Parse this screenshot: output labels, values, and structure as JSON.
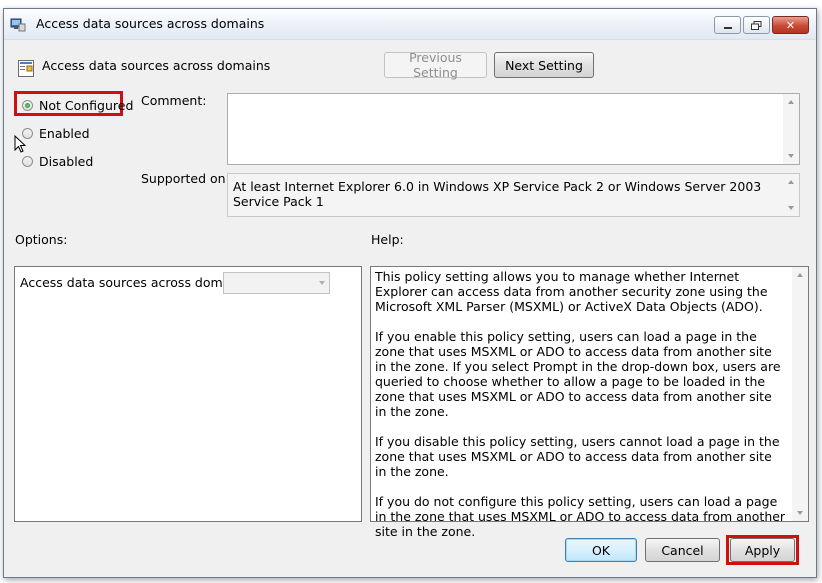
{
  "window": {
    "title": "Access data sources across domains",
    "minimize_icon": "minimize-icon",
    "maximize_icon": "maximize-icon",
    "close_icon": "close-icon"
  },
  "header": {
    "policy_name": "Access data sources across domains",
    "previous_label": "Previous Setting",
    "next_label": "Next Setting"
  },
  "state": {
    "options": [
      {
        "label": "Not Configured",
        "checked": true
      },
      {
        "label": "Enabled",
        "checked": false
      },
      {
        "label": "Disabled",
        "checked": false
      }
    ]
  },
  "comment": {
    "label": "Comment:",
    "value": ""
  },
  "supported": {
    "label": "Supported on:",
    "value": "At least Internet Explorer 6.0 in Windows XP Service Pack 2 or Windows Server 2003 Service Pack 1"
  },
  "options_section": {
    "label": "Options:",
    "option_label": "Access data sources across domains",
    "dropdown_value": ""
  },
  "help": {
    "label": "Help:",
    "paragraphs": [
      "This policy setting allows you to manage whether Internet Explorer can access data from another security zone using the Microsoft XML Parser (MSXML) or ActiveX Data Objects (ADO).",
      "If you enable this policy setting, users can load a page in the zone that uses MSXML or ADO to access data from another site in the zone. If you select Prompt in the drop-down box, users are queried to choose whether to allow a page to be loaded in the zone that uses MSXML or ADO to access data from another site in the zone.",
      "If you disable this policy setting, users cannot load a page in the zone that uses MSXML or ADO to access data from another site in the zone.",
      "If you do not configure this policy setting, users can load a page in the zone that uses MSXML or ADO to access data from another site in the zone."
    ]
  },
  "footer": {
    "ok_label": "OK",
    "cancel_label": "Cancel",
    "apply_label": "Apply"
  },
  "colors": {
    "highlight": "#d20f0f",
    "accent": "#3c7fb1"
  }
}
